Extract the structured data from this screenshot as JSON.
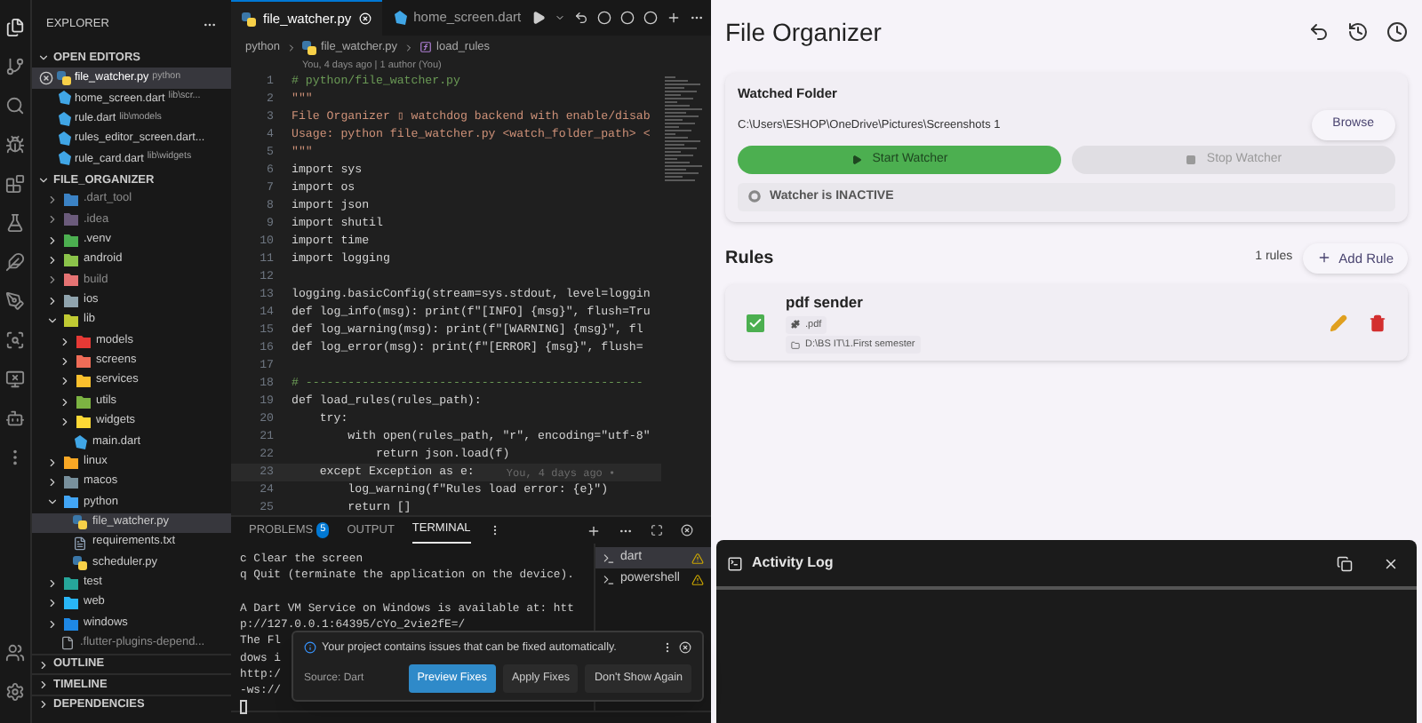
{
  "explorer": {
    "title": "EXPLORER",
    "open_editors": {
      "title": "OPEN EDITORS",
      "expanded": true,
      "items": [
        {
          "name": "file_watcher.py",
          "path": "python",
          "kind": "python",
          "selected": true
        },
        {
          "name": "home_screen.dart",
          "path": "lib\\scr...",
          "kind": "dart",
          "selected": false
        },
        {
          "name": "rule.dart",
          "path": "lib\\models",
          "kind": "dart",
          "selected": false
        },
        {
          "name": "rules_editor_screen.dart...",
          "kind": "dart",
          "selected": false
        },
        {
          "name": "rule_card.dart",
          "path": "lib\\widgets",
          "kind": "dart",
          "selected": false
        }
      ]
    },
    "project": {
      "title": "FILE_ORGANIZER",
      "expanded": true,
      "items": [
        {
          "name": ".dart_tool",
          "kind": "folder",
          "color": "#3b82c4",
          "expanded": false,
          "dimmed": true
        },
        {
          "name": ".idea",
          "kind": "folder",
          "color": "#6b5b7b",
          "expanded": false,
          "dimmed": true
        },
        {
          "name": ".venv",
          "kind": "folder",
          "color": "#4caf50",
          "expanded": false,
          "dimmed": false
        },
        {
          "name": "android",
          "kind": "folder",
          "color": "#8bc34a",
          "expanded": false,
          "dimmed": false
        },
        {
          "name": "build",
          "kind": "folder",
          "color": "#e57373",
          "expanded": false,
          "dimmed": true
        },
        {
          "name": "ios",
          "kind": "folder",
          "color": "#90a4ae",
          "expanded": false,
          "dimmed": false
        },
        {
          "name": "lib",
          "kind": "folder",
          "color": "#c0ca33",
          "expanded": true,
          "dimmed": false,
          "children": [
            {
              "name": "models",
              "kind": "folder",
              "color": "#e53935",
              "expanded": false,
              "dimmed": false
            },
            {
              "name": "screens",
              "kind": "folder",
              "color": "#ef6c57",
              "expanded": false,
              "dimmed": false
            },
            {
              "name": "services",
              "kind": "folder",
              "color": "#fbc02d",
              "expanded": false,
              "dimmed": false
            },
            {
              "name": "utils",
              "kind": "folder",
              "color": "#7cb342",
              "expanded": false,
              "dimmed": false
            },
            {
              "name": "widgets",
              "kind": "folder",
              "color": "#fdd835",
              "expanded": false,
              "dimmed": false
            },
            {
              "name": "main.dart",
              "kind": "dart",
              "selected": false
            }
          ]
        },
        {
          "name": "linux",
          "kind": "folder",
          "color": "#f9a825",
          "expanded": false,
          "dimmed": false
        },
        {
          "name": "macos",
          "kind": "folder",
          "color": "#78909c",
          "expanded": false,
          "dimmed": false
        },
        {
          "name": "python",
          "kind": "folder",
          "color": "#42a5f5",
          "expanded": true,
          "dimmed": false,
          "children": [
            {
              "name": "file_watcher.py",
              "kind": "python",
              "selected": true
            },
            {
              "name": "requirements.txt",
              "kind": "text",
              "selected": false
            },
            {
              "name": "scheduler.py",
              "kind": "python",
              "selected": false
            }
          ]
        },
        {
          "name": "test",
          "kind": "folder",
          "color": "#26a69a",
          "expanded": false,
          "dimmed": false
        },
        {
          "name": "web",
          "kind": "folder",
          "color": "#29b6f6",
          "expanded": false,
          "dimmed": false
        },
        {
          "name": "windows",
          "kind": "folder",
          "color": "#1e88e5",
          "expanded": false,
          "dimmed": false
        },
        {
          "name": ".flutter-plugins-depend...",
          "kind": "file",
          "dimmed": true
        }
      ]
    },
    "sections": [
      "OUTLINE",
      "TIMELINE",
      "DEPENDENCIES"
    ]
  },
  "editor": {
    "tabs": [
      {
        "label": "file_watcher.py",
        "kind": "python",
        "selected": true
      },
      {
        "label": "home_screen.dart",
        "kind": "dart",
        "selected": false
      }
    ],
    "breadcrumb": [
      "python",
      "file_watcher.py",
      "load_rules"
    ],
    "blame": "You, 4 days ago | 1 author (You)",
    "lines": [
      {
        "number": "1",
        "text": "# python/file_watcher.py",
        "kind": "comment"
      },
      {
        "number": "2",
        "text": "\"\"\"",
        "kind": "string"
      },
      {
        "number": "3",
        "text": "File Organizer ▯ watchdog backend with enable/disab",
        "kind": "string"
      },
      {
        "number": "4",
        "text": "Usage: python file_watcher.py <watch_folder_path> <",
        "kind": "string"
      },
      {
        "number": "5",
        "text": "\"\"\"",
        "kind": "string"
      },
      {
        "number": "6",
        "text": "import sys",
        "kind": "code"
      },
      {
        "number": "7",
        "text": "import os",
        "kind": "code"
      },
      {
        "number": "8",
        "text": "import json",
        "kind": "code"
      },
      {
        "number": "9",
        "text": "import shutil",
        "kind": "code"
      },
      {
        "number": "10",
        "text": "import time",
        "kind": "code"
      },
      {
        "number": "11",
        "text": "import logging",
        "kind": "code"
      },
      {
        "number": "12"
      },
      {
        "number": "13",
        "text": "logging.basicConfig(stream=sys.stdout, level=loggin",
        "kind": "code"
      },
      {
        "number": "14",
        "text": "def log_info(msg): print(f\"[INFO] {msg}\", flush=Tru",
        "kind": "code"
      },
      {
        "number": "15",
        "text": "def log_warning(msg): print(f\"[WARNING] {msg}\", fl",
        "kind": "code"
      },
      {
        "number": "16",
        "text": "def log_error(msg): print(f\"[ERROR] {msg}\", flush=",
        "kind": "code"
      },
      {
        "number": "17"
      },
      {
        "number": "18",
        "text": "# ------------------------------------------------",
        "kind": "comment"
      },
      {
        "number": "19",
        "text": "def load_rules(rules_path):",
        "kind": "code"
      },
      {
        "number": "20",
        "text": "    try:",
        "kind": "code"
      },
      {
        "number": "21",
        "text": "        with open(rules_path, \"r\", encoding=\"utf-8\"",
        "kind": "code"
      },
      {
        "number": "22",
        "text": "            return json.load(f)",
        "kind": "code"
      },
      {
        "number": "23",
        "text": "    except Exception as e:",
        "kind": "code",
        "current": true,
        "blame": "You, 4 days ago •"
      },
      {
        "number": "24",
        "text": "        log_warning(f\"Rules load error: {e}\")",
        "kind": "code"
      },
      {
        "number": "25",
        "text": "        return []",
        "kind": "code"
      }
    ]
  },
  "panel": {
    "tabs": [
      {
        "label": "PROBLEMS",
        "badge": "5",
        "selected": false
      },
      {
        "label": "OUTPUT",
        "selected": false
      },
      {
        "label": "TERMINAL",
        "selected": true
      }
    ],
    "terminal_lines": [
      {
        "text": "c Clear the screen",
        "gap_before": false
      },
      {
        "text": "q Quit (terminate the application on the device).",
        "gap_before": false
      },
      {
        "text": "A Dart VM Service on Windows is available at: htt",
        "gap_before": true
      },
      {
        "text": "p://127.0.0.1:64395/cYo_2vie2fE=/",
        "gap_before": false
      },
      {
        "text": "The Fl",
        "gap_before": false
      },
      {
        "text": "dows i",
        "gap_before": false
      },
      {
        "text": "http:/",
        "gap_before": false
      },
      {
        "text": "-ws://",
        "gap_before": false
      }
    ],
    "terminals": [
      {
        "name": "dart",
        "selected": true
      },
      {
        "name": "powershell",
        "selected": false
      }
    ],
    "notification": {
      "message": "Your project contains issues that can be fixed automatically.",
      "source": "Source: Dart",
      "buttons": [
        {
          "label": "Preview Fixes",
          "primary": true
        },
        {
          "label": "Apply Fixes",
          "primary": false
        },
        {
          "label": "Don't Show Again",
          "primary": false
        }
      ]
    }
  },
  "app": {
    "title": "File Organizer",
    "watched_folder": {
      "heading": "Watched Folder",
      "path": "C:\\Users\\ESHOP\\OneDrive\\Pictures\\Screenshots 1",
      "browse": "Browse",
      "start": {
        "label": "Start Watcher",
        "disabled": false
      },
      "stop": {
        "label": "Stop Watcher",
        "disabled": true
      },
      "status": "Watcher is INACTIVE",
      "active": false
    },
    "rules": {
      "heading": "Rules",
      "count": "1 rules",
      "add": "Add Rule",
      "items": [
        {
          "name": "pdf sender",
          "checked": true,
          "extension": ".pdf",
          "destination": "D:\\BS IT\\1.First semester"
        }
      ]
    },
    "log": {
      "title": "Activity Log"
    }
  }
}
